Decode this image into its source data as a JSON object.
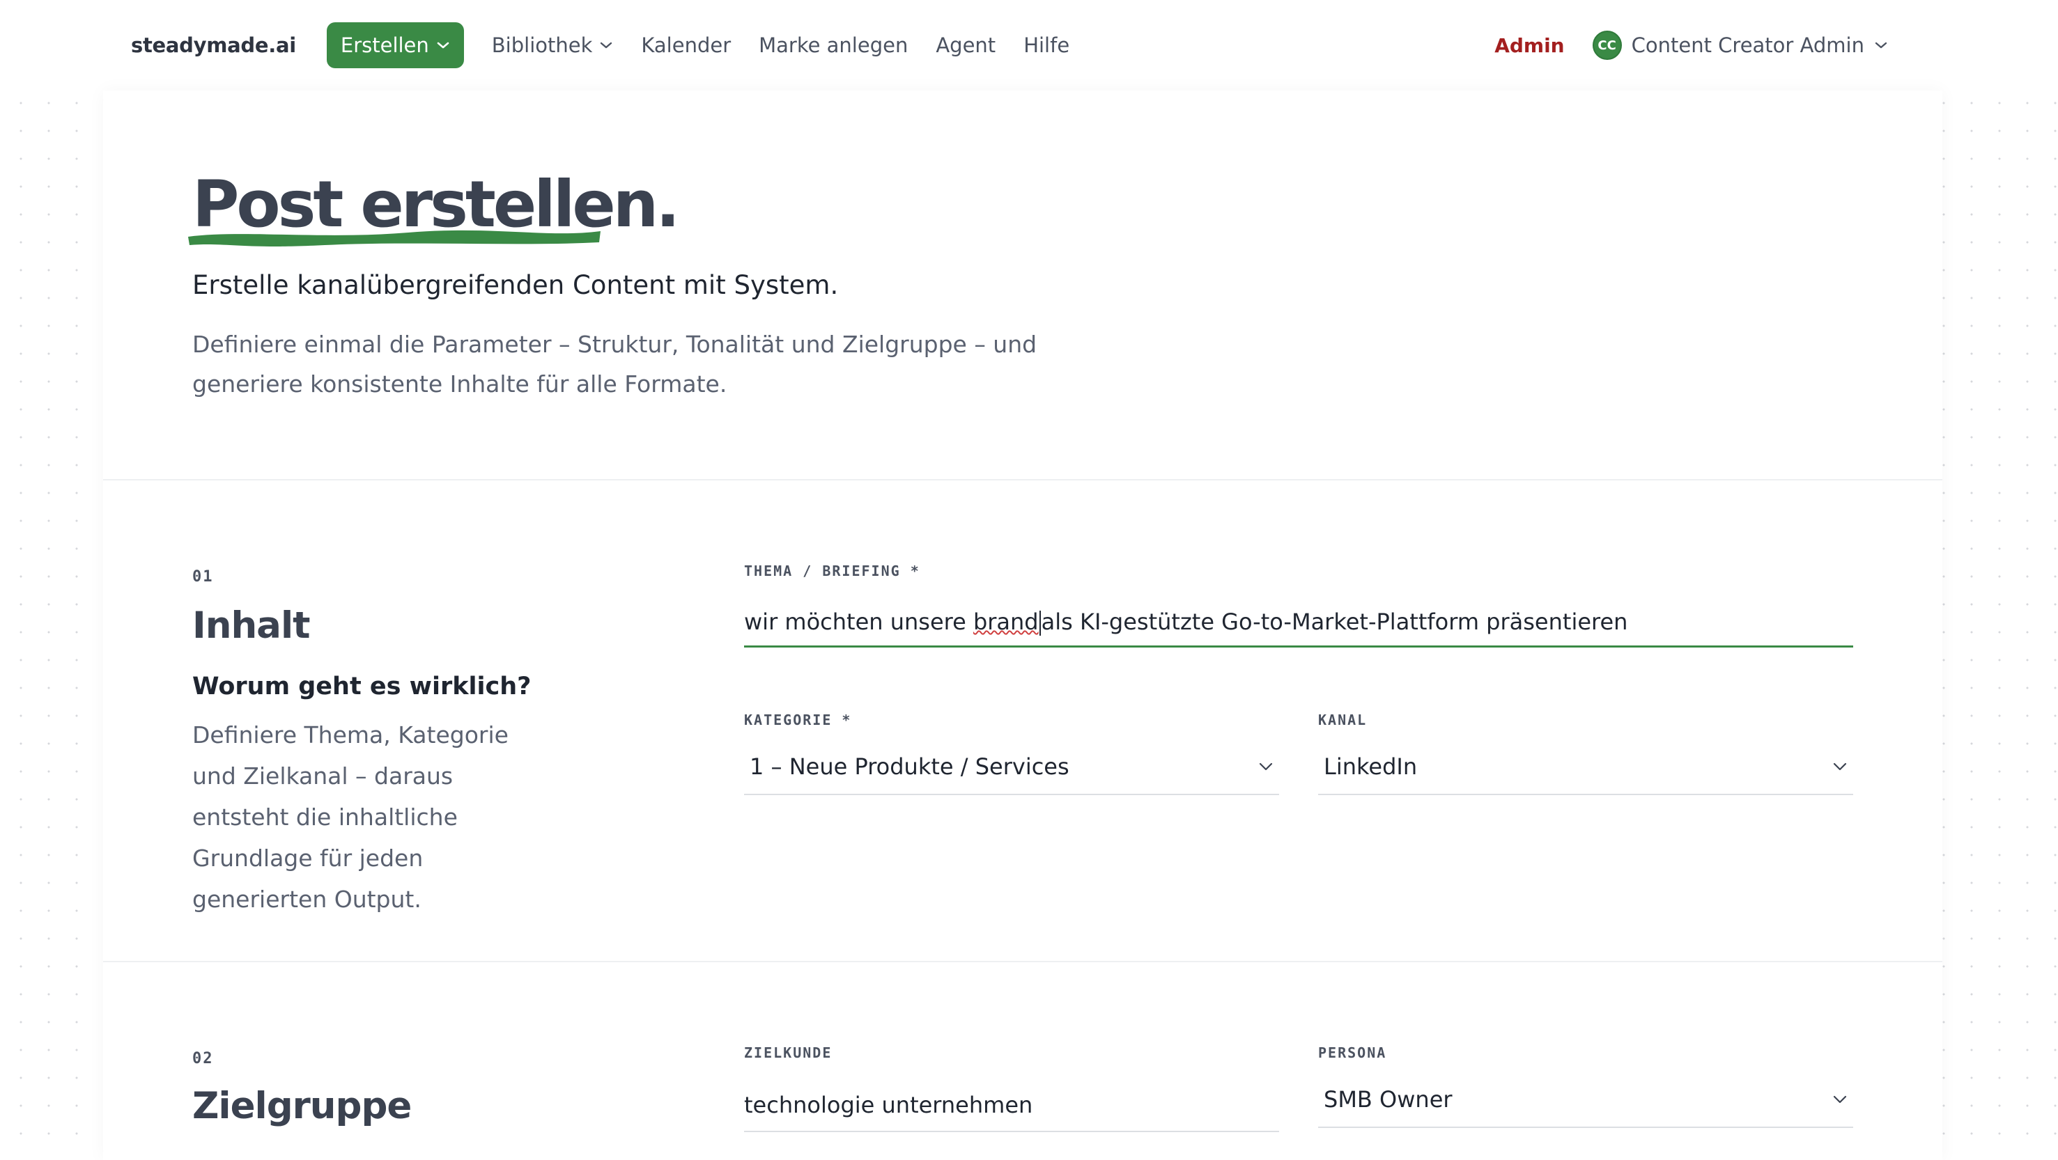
{
  "nav": {
    "brand": "steadymade.ai",
    "items": [
      {
        "label": "Erstellen",
        "dropdown": true,
        "active": true
      },
      {
        "label": "Bibliothek",
        "dropdown": true,
        "active": false
      },
      {
        "label": "Kalender",
        "dropdown": false,
        "active": false
      },
      {
        "label": "Marke anlegen",
        "dropdown": false,
        "active": false
      },
      {
        "label": "Agent",
        "dropdown": false,
        "active": false
      },
      {
        "label": "Hilfe",
        "dropdown": false,
        "active": false
      }
    ],
    "admin_label": "Admin",
    "user": {
      "initials": "CC",
      "name": "Content Creator Admin"
    }
  },
  "hero": {
    "title": "Post erstellen.",
    "subtitle": "Erstelle kanalübergreifenden Content mit System.",
    "description": "Definiere einmal die Parameter – Struktur, Tonalität und Zielgruppe – und generiere konsistente Inhalte für alle Formate."
  },
  "sections": [
    {
      "number": "01",
      "title": "Inhalt",
      "question": "Worum geht es wirklich?",
      "description": "Definiere Thema, Kategorie und Zielkanal – daraus entsteht die inhaltliche Grundlage für jeden generierten Output.",
      "fields": {
        "topic": {
          "label": "THEMA / BRIEFING *",
          "value_before": "wir möchten unsere ",
          "value_misspelled": "brand",
          "value_after": "als KI-gestützte Go-to-Market-Plattform präsentieren"
        },
        "category": {
          "label": "KATEGORIE *",
          "value": "1 – Neue Produkte / Services"
        },
        "channel": {
          "label": "KANAL",
          "value": "LinkedIn"
        }
      }
    },
    {
      "number": "02",
      "title": "Zielgruppe",
      "fields": {
        "target_customer": {
          "label": "ZIELKUNDE",
          "value": "technologie unternehmen"
        },
        "persona": {
          "label": "PERSONA",
          "value": "SMB Owner"
        }
      }
    }
  ],
  "colors": {
    "accent": "#3a8a45",
    "admin": "#a31f1f",
    "heading": "#3b4250",
    "muted_text": "#5a6170"
  }
}
